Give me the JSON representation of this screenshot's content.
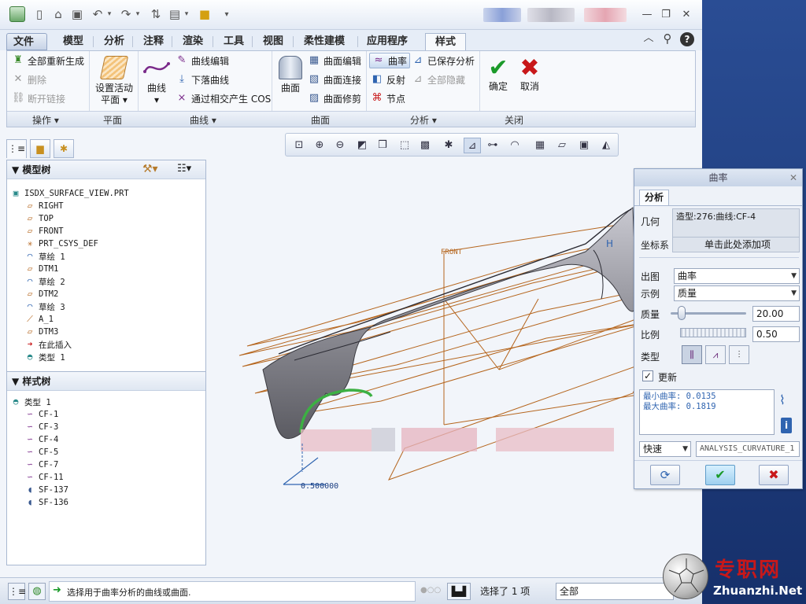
{
  "tabs": [
    {
      "label": "文件",
      "file": true
    },
    {
      "label": "模型"
    },
    {
      "label": "分析"
    },
    {
      "label": "注释"
    },
    {
      "label": "渲染"
    },
    {
      "label": "工具"
    },
    {
      "label": "视图"
    },
    {
      "label": "柔性建模"
    },
    {
      "label": "应用程序"
    },
    {
      "label": "样式",
      "active": true
    }
  ],
  "ribbon": {
    "ops": {
      "regen": "全部重新生成",
      "delete": "删除",
      "break": "断开链接",
      "group": "操作"
    },
    "plane": {
      "set_active": "设置活动",
      "set_active2": "平面",
      "group": "平面"
    },
    "curve": {
      "curve": "曲线",
      "edit": "曲线编辑",
      "drop": "下落曲线",
      "intersect": "通过相交产生 COS",
      "group": "曲线"
    },
    "surface": {
      "surface": "曲面",
      "edit": "曲面编辑",
      "connect": "曲面连接",
      "trim": "曲面修剪",
      "group": "曲面"
    },
    "analysis": {
      "curvature": "曲率",
      "saved": "已保存分析",
      "reflect": "反射",
      "hide_all": "全部隐藏",
      "node": "节点",
      "group": "分析"
    },
    "close": {
      "ok": "确定",
      "cancel": "取消",
      "group": "关闭"
    }
  },
  "model_tree": {
    "header": "模型树",
    "items": [
      {
        "label": "ISDX_SURFACE_VIEW.PRT",
        "icon": "part-icon"
      },
      {
        "label": "RIGHT",
        "icon": "datum-plane-icon"
      },
      {
        "label": "TOP",
        "icon": "datum-plane-icon"
      },
      {
        "label": "FRONT",
        "icon": "datum-plane-icon"
      },
      {
        "label": "PRT_CSYS_DEF",
        "icon": "csys-icon"
      },
      {
        "label": "草绘 1",
        "icon": "sketch-icon"
      },
      {
        "label": "DTM1",
        "icon": "datum-plane-icon"
      },
      {
        "label": "草绘 2",
        "icon": "sketch-icon"
      },
      {
        "label": "DTM2",
        "icon": "datum-plane-icon"
      },
      {
        "label": "草绘 3",
        "icon": "sketch-icon"
      },
      {
        "label": "A_1",
        "icon": "axis-icon"
      },
      {
        "label": "DTM3",
        "icon": "datum-plane-icon"
      },
      {
        "label": "在此插入",
        "icon": "insert-arrow-icon"
      },
      {
        "label": "类型 1",
        "icon": "style-icon"
      }
    ]
  },
  "style_tree": {
    "header": "样式树",
    "items": [
      {
        "label": "类型 1",
        "icon": "style-icon"
      },
      {
        "label": "CF-1",
        "icon": "free-curve-icon"
      },
      {
        "label": "CF-3",
        "icon": "free-curve-icon"
      },
      {
        "label": "CF-4",
        "icon": "free-curve-icon"
      },
      {
        "label": "CF-5",
        "icon": "free-curve-icon"
      },
      {
        "label": "CF-7",
        "icon": "free-curve-icon"
      },
      {
        "label": "CF-11",
        "icon": "free-curve-icon"
      },
      {
        "label": "SF-137",
        "icon": "surface-icon"
      },
      {
        "label": "SF-136",
        "icon": "surface-icon"
      }
    ]
  },
  "canvas": {
    "front_label": "FRONT",
    "scale_label": "0.500000"
  },
  "dialog": {
    "title": "曲率",
    "tab": "分析",
    "geometry_label": "几何",
    "geometry_value": "造型:276:曲线:CF-4",
    "csys_label": "坐标系",
    "csys_value": "单击此处添加项",
    "plot_label": "出图",
    "plot_value": "曲率",
    "example_label": "示例",
    "example_value": "质量",
    "quality_label": "质量",
    "quality_value": "20.00",
    "quality_fraction": 0.1,
    "scale_label": "比例",
    "scale_value": "0.50",
    "type_label": "类型",
    "update_label": "更新",
    "update_checked": true,
    "min_curv": "最小曲率: 0.0135",
    "max_curv": "最大曲率: 0.1819",
    "mode_value": "快速",
    "name_value": "ANALYSIS_CURVATURE_1"
  },
  "status": {
    "message": "选择用于曲率分析的曲线或曲面.",
    "selected": "选择了 1 项",
    "filter": "全部"
  },
  "watermark": {
    "cn": "专职网",
    "url": "Zhuanzhi.Net"
  },
  "colors": {
    "accent": "#2f64b0",
    "ok_green": "#1b9a2a",
    "cancel_red": "#c8181a",
    "curve_orange": "#b5651d",
    "surface_gray": "#8e8e96",
    "highlight_green": "#3cb043"
  }
}
